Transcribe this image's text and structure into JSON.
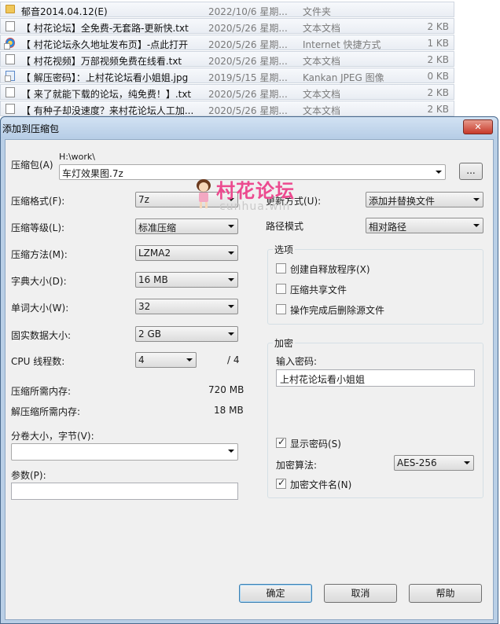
{
  "files": [
    {
      "icon": "folder-icon",
      "name": "郁音2014.04.12(E)",
      "date": "2022/10/6 星期...",
      "type": "文件夹",
      "size": ""
    },
    {
      "icon": "text-file-icon",
      "name": "【 村花论坛】全免费-无套路-更新快.txt",
      "date": "2020/5/26 星期...",
      "type": "文本文档",
      "size": "2 KB"
    },
    {
      "icon": "internet-shortcut-icon",
      "name": "【 村花论坛永久地址发布页】-点此打开",
      "date": "2020/5/26 星期...",
      "type": "Internet 快捷方式",
      "size": "1 KB"
    },
    {
      "icon": "text-file-icon",
      "name": "【 村花视频】万部视频免费在线看.txt",
      "date": "2020/5/26 星期...",
      "type": "文本文档",
      "size": "2 KB"
    },
    {
      "icon": "image-file-icon",
      "name": "【 解压密码】：上村花论坛看小姐姐.jpg",
      "date": "2019/5/15 星期...",
      "type": "Kankan JPEG 图像",
      "size": "0 KB"
    },
    {
      "icon": "text-file-icon",
      "name": "【 来了就能下载的论坛，纯免费！】.txt",
      "date": "2020/5/26 星期...",
      "type": "文本文档",
      "size": "2 KB"
    },
    {
      "icon": "text-file-icon",
      "name": "【 有种子却没速度？来村花论坛人工加...",
      "date": "2020/5/26 星期...",
      "type": "文本文档",
      "size": "2 KB"
    }
  ],
  "dialog": {
    "title": "添加到压缩包",
    "close_glyph": "✕",
    "archive_label": "压缩包(A)",
    "archive_path": "H:\\work\\",
    "archive_name": "车灯效果图.7z",
    "browse_label": "...",
    "format_label": "压缩格式(F):",
    "format_value": "7z",
    "level_label": "压缩等级(L):",
    "level_value": "标准压缩",
    "method_label": "压缩方法(M):",
    "method_value": "LZMA2",
    "dict_label": "字典大小(D):",
    "dict_value": "16 MB",
    "word_label": "单词大小(W):",
    "word_value": "32",
    "solid_label": "固实数据大小:",
    "solid_value": "2 GB",
    "cpu_label": "CPU 线程数:",
    "cpu_value": "4",
    "cpu_max": "/ 4",
    "mem_comp_label": "压缩所需内存:",
    "mem_comp_value": "720 MB",
    "mem_decomp_label": "解压缩所需内存:",
    "mem_decomp_value": "18 MB",
    "split_label": "分卷大小，字节(V):",
    "split_value": "",
    "params_label": "参数(P):",
    "params_value": "",
    "update_label": "更新方式(U):",
    "update_value": "添加并替换文件",
    "pathmode_label": "路径模式",
    "pathmode_value": "相对路径",
    "options_title": "选项",
    "opt_sfx": "创建自释放程序(X)",
    "opt_shared": "压缩共享文件",
    "opt_delete": "操作完成后删除源文件",
    "encrypt_title": "加密",
    "password_label": "输入密码:",
    "password_value": "上村花论坛看小姐姐",
    "show_password": "显示密码(S)",
    "enc_method_label": "加密算法:",
    "enc_method_value": "AES-256",
    "encrypt_names": "加密文件名(N)",
    "ok": "确定",
    "cancel": "取消",
    "help": "帮助"
  },
  "watermark": {
    "title": "村花论坛",
    "url": "cunhua.win"
  },
  "colors": {
    "titlebar": "#c4d8ee",
    "close": "#c7392a",
    "watermark": "#ec4a8f"
  }
}
